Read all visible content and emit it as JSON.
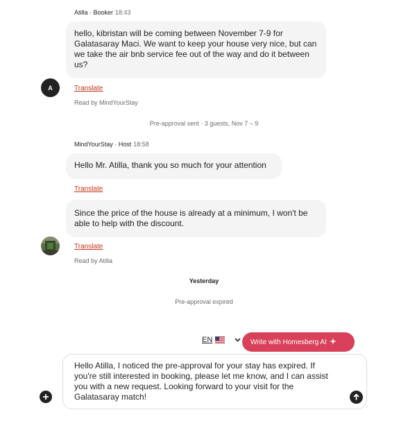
{
  "thread": {
    "guest_message": {
      "sender": "Atilla · Booker",
      "time": "18:43",
      "text": "hello, kibristan will be coming between November 7-9 for Galatasaray Maci. We want to keep your house very nice, but can we take the air bnb service fee out of the way and do it between us?",
      "translate_label": "Translate",
      "avatar_letter": "A",
      "read_by": "Read by MindYourStay"
    },
    "preapproval_note": "Pre-approval sent · 3 guests, Nov 7 – 9",
    "host_messages": {
      "sender": "MindYourStay · Host",
      "time": "18:58",
      "first_text": "Hello Mr. Atilla, thank you so much for your attention",
      "first_translate": "Translate",
      "second_text": "Since the price of the house is already at a minimum, I won't be able to help with the discount.",
      "second_translate": "Translate",
      "read_by": "Read by Atilla"
    },
    "day_divider": "Yesterday",
    "expired_note": "Pre-approval expired"
  },
  "composer": {
    "language_code": "EN",
    "language_flag_icon": "us-flag-icon",
    "ai_button_label": "Write with Homesberg AI",
    "draft_text": "Hello Atilla, I noticed the pre-approval for your stay has expired. If you're still interested in booking, please let me know, and I can assist you with a new request. Looking forward to your visit for the Galatasaray match!"
  },
  "colors": {
    "link": "#c13515",
    "ai_button": "#d9415a",
    "bubble": "#f4f4f4",
    "muted_text": "#6a6a6a"
  }
}
